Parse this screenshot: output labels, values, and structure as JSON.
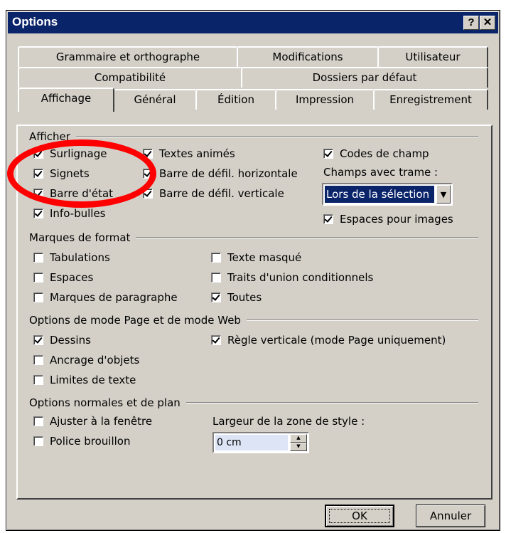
{
  "window": {
    "title": "Options",
    "help_label": "?",
    "close_label": "✕"
  },
  "tabs": {
    "row1": [
      "Grammaire et orthographe",
      "Modifications",
      "Utilisateur"
    ],
    "row2": [
      "Compatibilité",
      "Dossiers par défaut"
    ],
    "row3": [
      "Affichage",
      "Général",
      "Édition",
      "Impression",
      "Enregistrement"
    ],
    "active": "Affichage"
  },
  "afficher": {
    "label": "Afficher",
    "soulignage": "Surlignage",
    "signets": "Signets",
    "barre_etat": "Barre d'état",
    "info_bulles": "Info-bulles",
    "textes_animes": "Textes animés",
    "barre_h": "Barre de défil. horizontale",
    "barre_v": "Barre de défil. verticale",
    "codes_champ": "Codes de champ",
    "champs_trame_label": "Champs avec trame :",
    "champs_trame_value": "Lors de la sélection",
    "espaces_images": "Espaces pour images"
  },
  "marques": {
    "label": "Marques de format",
    "tabulations": "Tabulations",
    "espaces": "Espaces",
    "marques_para": "Marques de paragraphe",
    "texte_masque": "Texte masqué",
    "traits_union": "Traits d'union conditionnels",
    "toutes": "Toutes"
  },
  "mode_page": {
    "label": "Options de mode Page et de mode Web",
    "dessins": "Dessins",
    "ancrage": "Ancrage d'objets",
    "limites": "Limites de texte",
    "regle": "Règle verticale (mode Page uniquement)"
  },
  "normales": {
    "label": "Options normales et de plan",
    "ajuster": "Ajuster à la fenêtre",
    "police": "Police brouillon",
    "largeur_label": "Largeur de la zone de style :",
    "largeur_value": "0 cm"
  },
  "buttons": {
    "ok": "OK",
    "cancel": "Annuler"
  },
  "colors": {
    "titlebar": "#0a246a",
    "dialog": "#d4d0c8",
    "highlight_circle": "#ff0000"
  }
}
